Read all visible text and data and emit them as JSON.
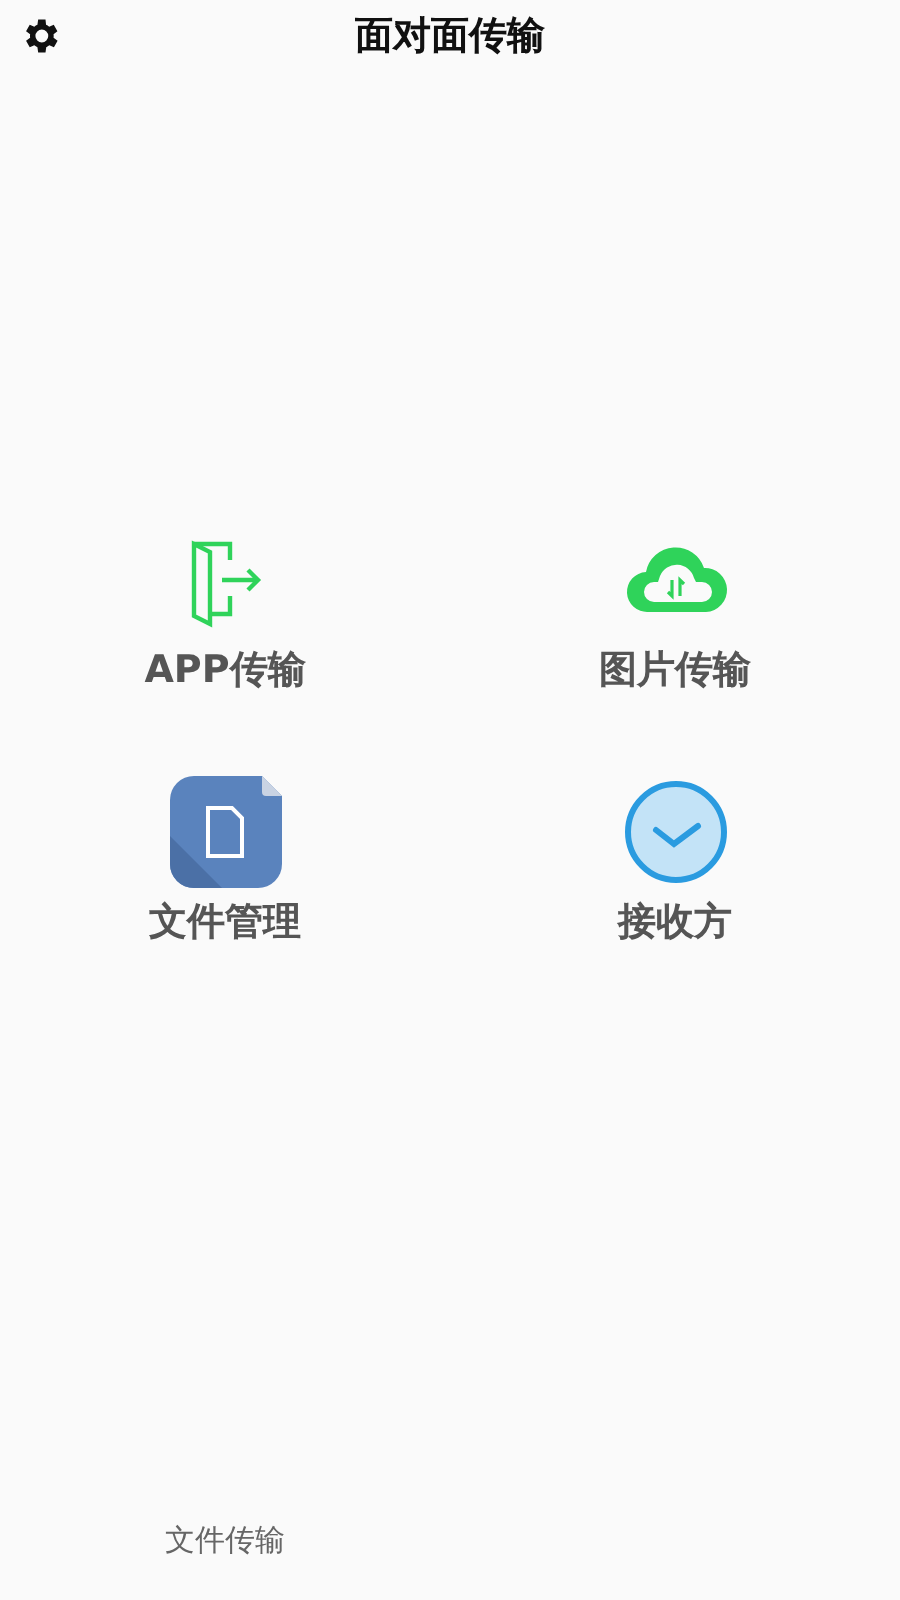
{
  "header": {
    "title": "面对面传输"
  },
  "actions": [
    {
      "kind": "door",
      "label": "APP传输"
    },
    {
      "kind": "cloud",
      "label": "图片传输"
    },
    {
      "kind": "document",
      "label": "文件管理"
    },
    {
      "kind": "check",
      "label": "接收方"
    }
  ],
  "bottom_tabs": [
    {
      "label": "文件传输"
    }
  ]
}
